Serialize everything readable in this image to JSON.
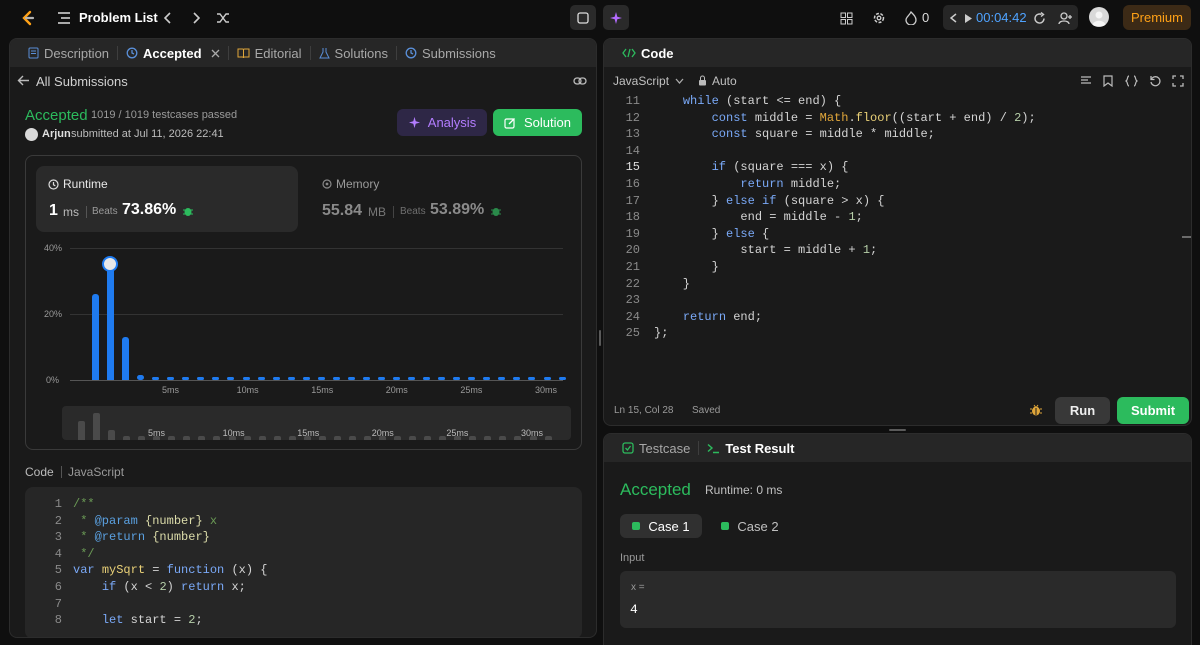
{
  "topbar": {
    "title": "Problem List",
    "streak": "0",
    "timer": "00:04:42",
    "premium": "Premium"
  },
  "left": {
    "tabs": [
      "Description",
      "Accepted",
      "Editorial",
      "Solutions",
      "Submissions"
    ],
    "back": "All Submissions",
    "status": "Accepted",
    "testcases": "1019 / 1019 testcases passed",
    "user": "Arjun",
    "submitted": "submitted at Jul 11, 2026 22:41",
    "analysis_btn": "Analysis",
    "solution_btn": "Solution",
    "runtime": {
      "label": "Runtime",
      "value": "1",
      "unit": "ms",
      "beats_label": "Beats",
      "beats": "73.86%"
    },
    "memory": {
      "label": "Memory",
      "value": "55.84",
      "unit": "MB",
      "beats_label": "Beats",
      "beats": "53.89%"
    },
    "code_label": "Code",
    "code_lang": "JavaScript"
  },
  "chart_data": {
    "type": "bar",
    "ylabels": [
      "40%",
      "20%",
      "0%"
    ],
    "ylim": [
      0,
      40
    ],
    "xticks": [
      "5ms",
      "10ms",
      "15ms",
      "20ms",
      "25ms",
      "30ms"
    ],
    "values": [
      26,
      36,
      13,
      1.5,
      1,
      1,
      1,
      1,
      1,
      1,
      1,
      1,
      1,
      1,
      1,
      1,
      1,
      1,
      1,
      1,
      1,
      1,
      1,
      1,
      1,
      1,
      1,
      1,
      1,
      1,
      1,
      1
    ],
    "highlight_index": 1
  },
  "left_code": [
    {
      "n": "1",
      "t": "/**"
    },
    {
      "n": "2",
      "t": " * @param {number} x"
    },
    {
      "n": "3",
      "t": " * @return {number}"
    },
    {
      "n": "4",
      "t": " */"
    },
    {
      "n": "5",
      "t": "var mySqrt = function (x) {"
    },
    {
      "n": "6",
      "t": "    if (x < 2) return x;"
    },
    {
      "n": "7",
      "t": ""
    },
    {
      "n": "8",
      "t": "    let start = 2;"
    }
  ],
  "editor": {
    "title": "Code",
    "lang": "JavaScript",
    "mode": "Auto",
    "cursor": "Ln 15, Col 28",
    "saved": "Saved",
    "run": "Run",
    "submit": "Submit",
    "lines": [
      {
        "n": "11",
        "t": "    while (start <= end) {"
      },
      {
        "n": "12",
        "t": "        const middle = Math.floor((start + end) / 2);"
      },
      {
        "n": "13",
        "t": "        const square = middle * middle;"
      },
      {
        "n": "14",
        "t": ""
      },
      {
        "n": "15",
        "t": "        if (square === x) {"
      },
      {
        "n": "16",
        "t": "            return middle;"
      },
      {
        "n": "17",
        "t": "        } else if (square > x) {"
      },
      {
        "n": "18",
        "t": "            end = middle - 1;"
      },
      {
        "n": "19",
        "t": "        } else {"
      },
      {
        "n": "20",
        "t": "            start = middle + 1;"
      },
      {
        "n": "21",
        "t": "        }"
      },
      {
        "n": "22",
        "t": "    }"
      },
      {
        "n": "23",
        "t": ""
      },
      {
        "n": "24",
        "t": "    return end;"
      },
      {
        "n": "25",
        "t": "};"
      }
    ]
  },
  "result": {
    "tab_testcase": "Testcase",
    "tab_result": "Test Result",
    "status": "Accepted",
    "runtime": "Runtime: 0 ms",
    "case1": "Case 1",
    "case2": "Case 2",
    "input_label": "Input",
    "var_label": "x =",
    "var_value": "4"
  }
}
